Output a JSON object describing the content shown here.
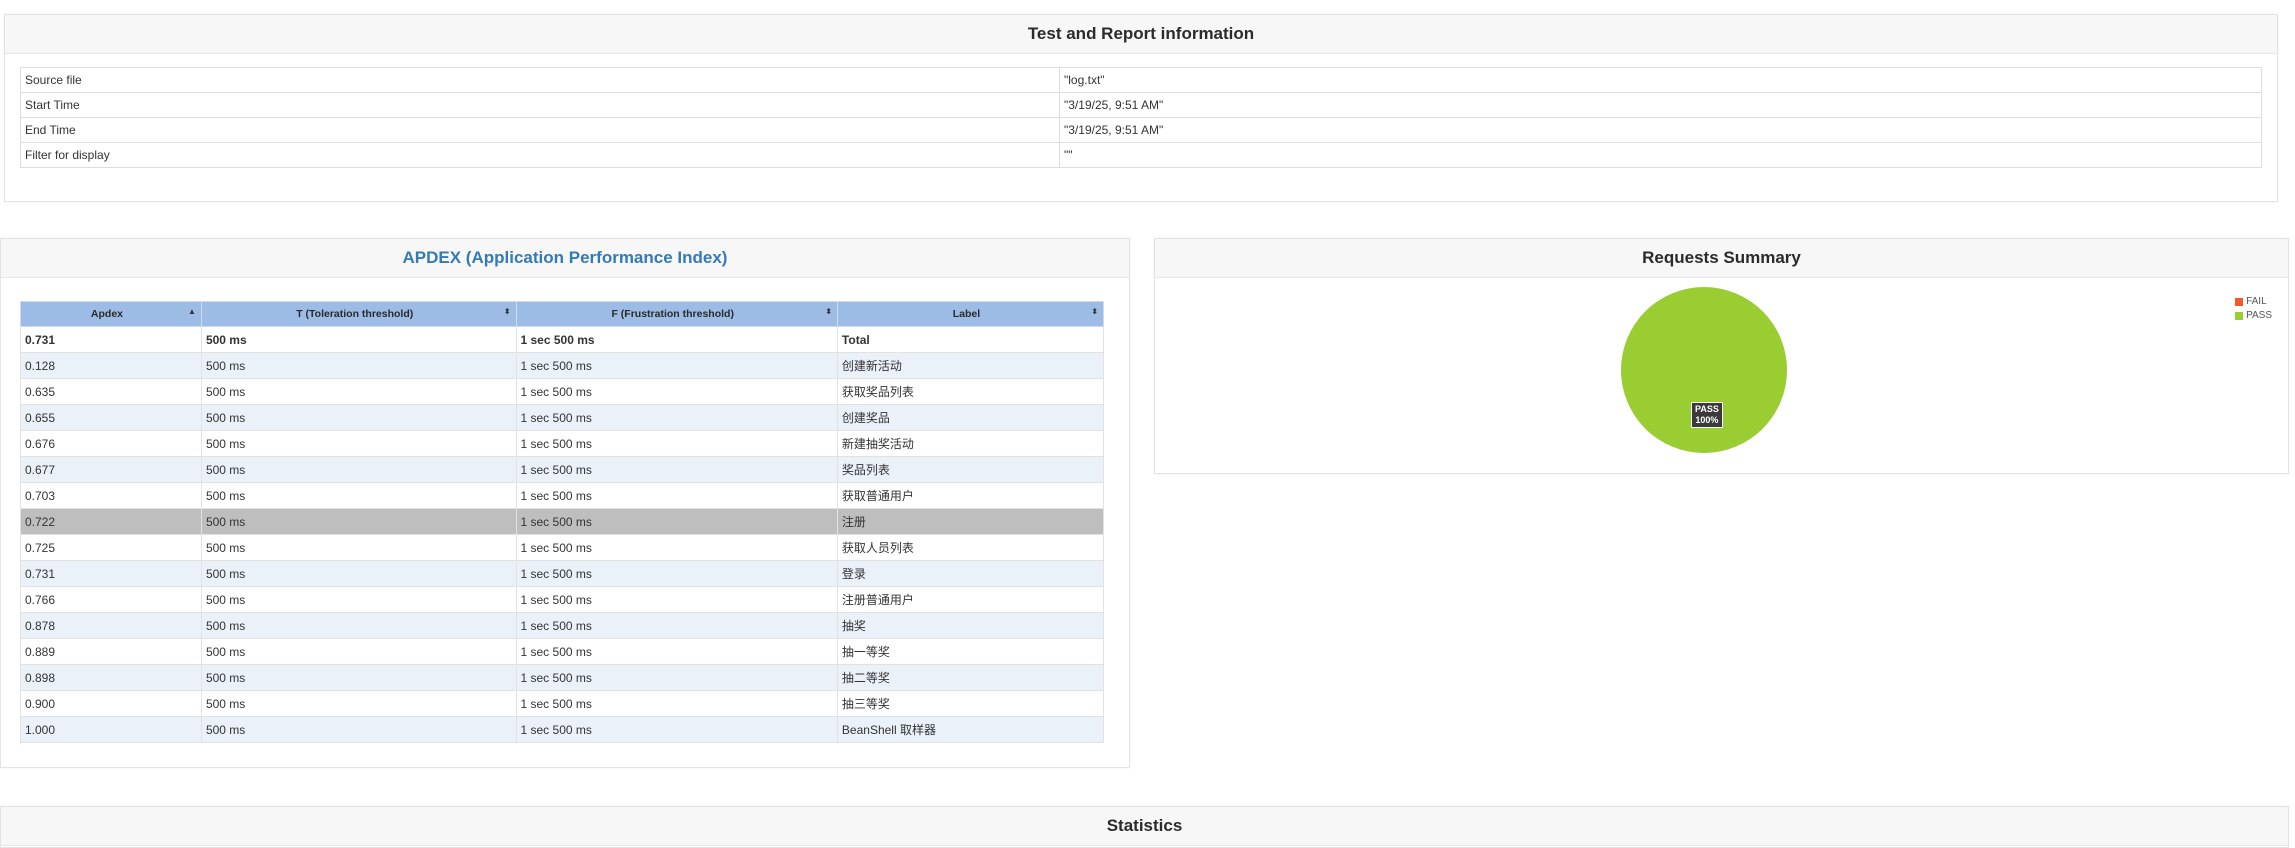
{
  "info": {
    "title": "Test and Report information",
    "rows": [
      {
        "key": "Source file",
        "value": "\"log.txt\""
      },
      {
        "key": "Start Time",
        "value": "\"3/19/25, 9:51 AM\""
      },
      {
        "key": "End Time",
        "value": "\"3/19/25, 9:51 AM\""
      },
      {
        "key": "Filter for display",
        "value": "\"\""
      }
    ]
  },
  "apdex": {
    "title": "APDEX (Application Performance Index)",
    "columns": [
      "Apdex",
      "T (Toleration threshold)",
      "F (Frustration threshold)",
      "Label"
    ],
    "sort_icons": [
      "▲",
      "⬍",
      "⬍",
      "⬍"
    ],
    "rows": [
      [
        "0.731",
        "500 ms",
        "1 sec 500 ms",
        "Total"
      ],
      [
        "0.128",
        "500 ms",
        "1 sec 500 ms",
        "创建新活动"
      ],
      [
        "0.635",
        "500 ms",
        "1 sec 500 ms",
        "获取奖品列表"
      ],
      [
        "0.655",
        "500 ms",
        "1 sec 500 ms",
        "创建奖品"
      ],
      [
        "0.676",
        "500 ms",
        "1 sec 500 ms",
        "新建抽奖活动"
      ],
      [
        "0.677",
        "500 ms",
        "1 sec 500 ms",
        "奖品列表"
      ],
      [
        "0.703",
        "500 ms",
        "1 sec 500 ms",
        "获取普通用户"
      ],
      [
        "0.722",
        "500 ms",
        "1 sec 500 ms",
        "注册"
      ],
      [
        "0.725",
        "500 ms",
        "1 sec 500 ms",
        "获取人员列表"
      ],
      [
        "0.731",
        "500 ms",
        "1 sec 500 ms",
        "登录"
      ],
      [
        "0.766",
        "500 ms",
        "1 sec 500 ms",
        "注册普通用户"
      ],
      [
        "0.878",
        "500 ms",
        "1 sec 500 ms",
        "抽奖"
      ],
      [
        "0.889",
        "500 ms",
        "1 sec 500 ms",
        "抽一等奖"
      ],
      [
        "0.898",
        "500 ms",
        "1 sec 500 ms",
        "抽二等奖"
      ],
      [
        "0.900",
        "500 ms",
        "1 sec 500 ms",
        "抽三等奖"
      ],
      [
        "1.000",
        "500 ms",
        "1 sec 500 ms",
        "BeanShell 取样器"
      ]
    ],
    "selected_row": 7
  },
  "requests": {
    "title": "Requests Summary",
    "legend": [
      {
        "label": "FAIL",
        "color": "#f15a2c"
      },
      {
        "label": "PASS",
        "color": "#9acd32"
      }
    ],
    "slice_label_name": "PASS",
    "slice_label_pct": "100%"
  },
  "chart_data": {
    "type": "pie",
    "title": "Requests Summary",
    "categories": [
      "FAIL",
      "PASS"
    ],
    "values": [
      0,
      100
    ],
    "colors": [
      "#f15a2c",
      "#9acd32"
    ],
    "legend": "top-right"
  },
  "statistics": {
    "title": "Statistics"
  }
}
